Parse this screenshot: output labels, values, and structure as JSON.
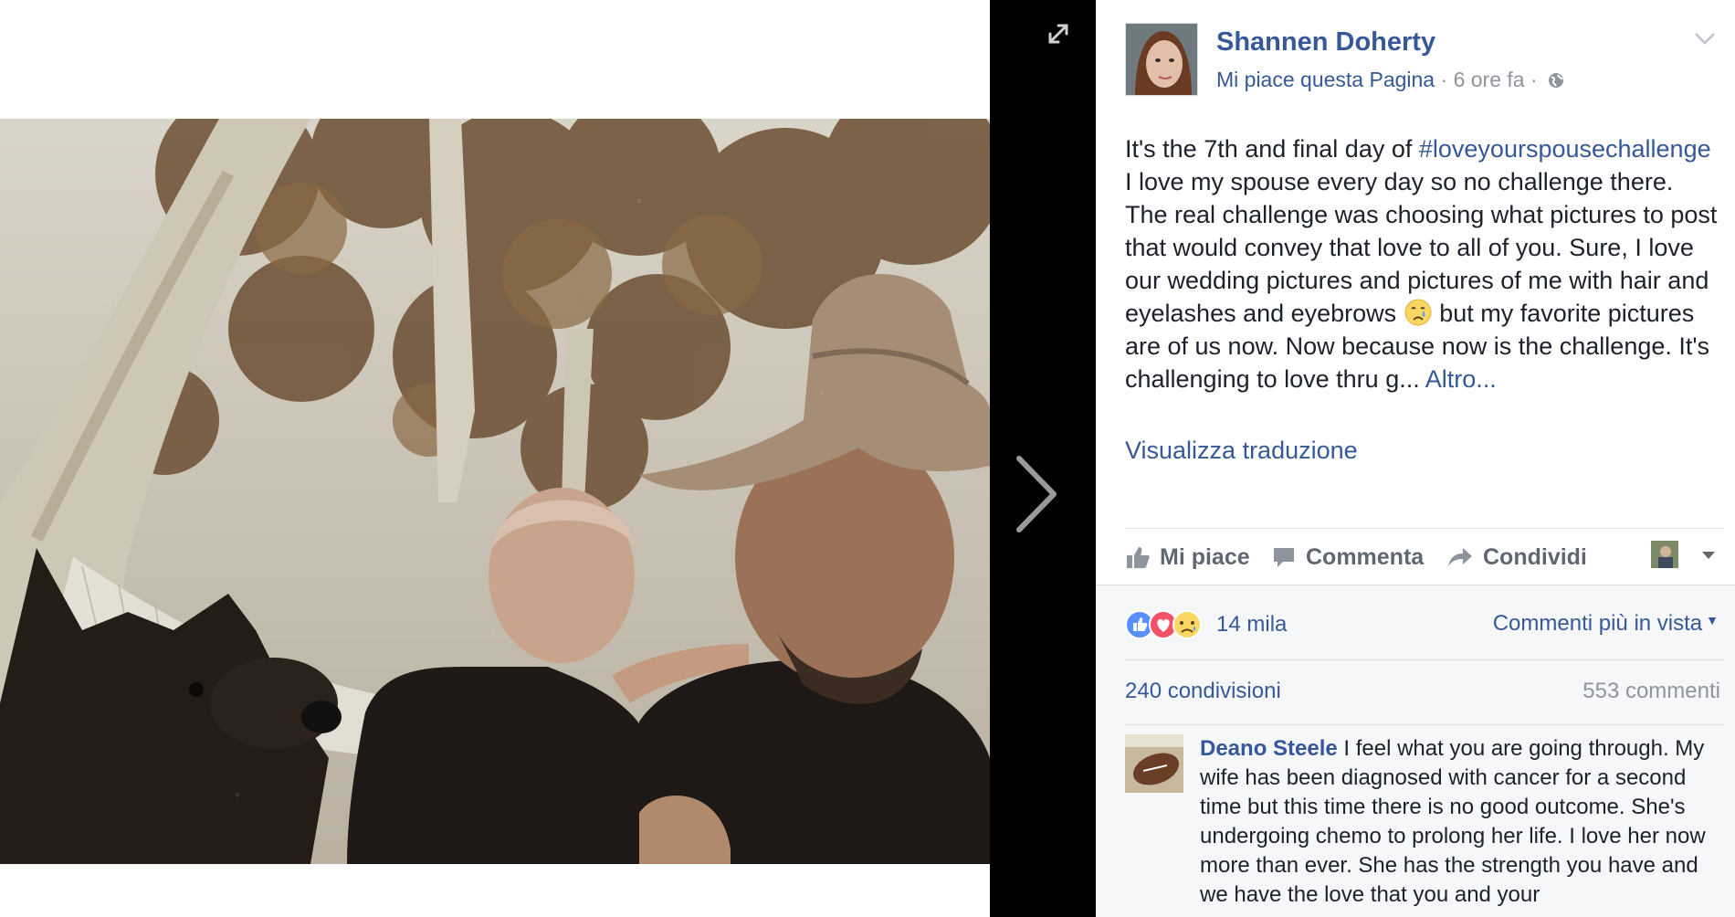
{
  "viewer": {
    "expand_icon": "expand-arrows-icon",
    "next_icon": "chevron-right-icon"
  },
  "post": {
    "page_name": "Shannen Doherty",
    "liked_page": "Mi piace questa Pagina",
    "separator": "·",
    "time": "6 ore fa",
    "audience_icon": "globe-icon",
    "text_before_hashtag": "It's the 7th and final day of ",
    "hashtag": "#loveyourspousechallenge",
    "text_after_hashtag": " I love my spouse every day so no challenge there. The real challenge was choosing what pictures to post that would convey that love to all of you. Sure, I love our wedding pictures and pictures of me with hair and eyelashes and eyebrows ",
    "emoji": "crying-face-emoji",
    "text_after_emoji": " but my favorite pictures are of us now. Now because now is the challenge. It's challenging to love thru g... ",
    "more_link": "Altro...",
    "translate_link": "Visualizza traduzione"
  },
  "actions": {
    "like": "Mi piace",
    "comment": "Commenta",
    "share": "Condividi"
  },
  "feedback": {
    "reactions_count": "14 mila",
    "reaction_types": [
      "like",
      "love",
      "sad"
    ],
    "sort_label": "Commenti più in vista",
    "shares": "240 condivisioni",
    "comments": "553 commenti"
  },
  "comment": {
    "author": "Deano Steele",
    "text": " I feel what you are going through. My wife has been diagnosed with cancer for a second time but this time there is no good outcome. She's undergoing chemo to prolong her life. I love her now more than ever. She has the strength you have and we have the love that you and your"
  },
  "colors": {
    "link_blue": "#365899",
    "meta_gray": "#90949c",
    "action_gray": "#606770",
    "like_blue": "#5890ff",
    "love_red": "#f25268",
    "sad_yellow": "#fcd663"
  }
}
